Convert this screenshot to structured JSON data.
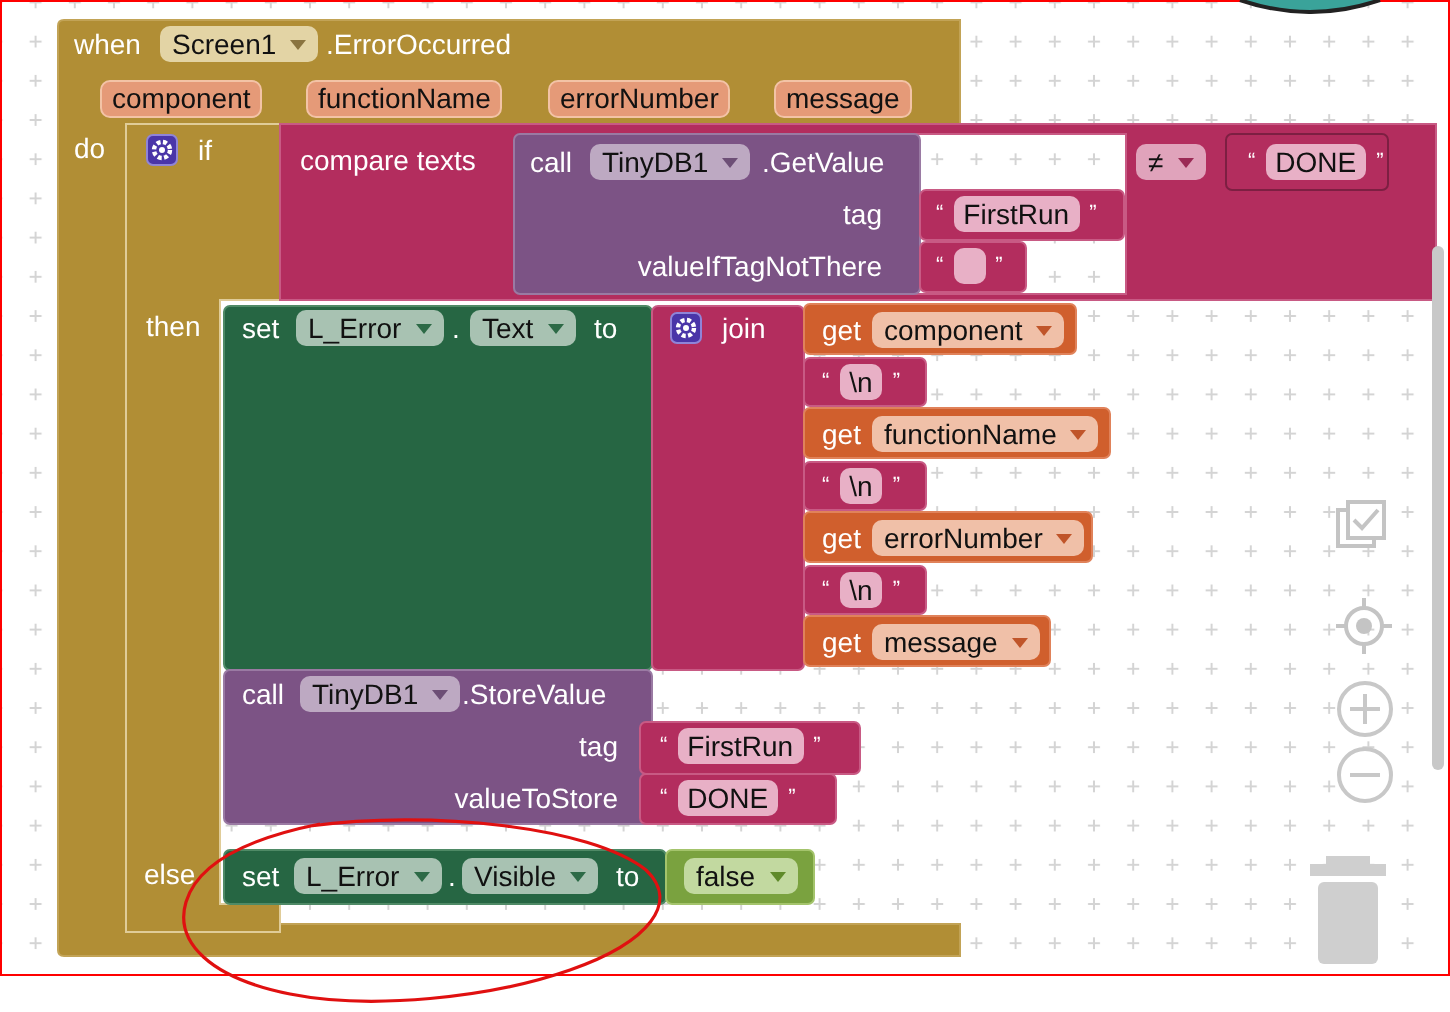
{
  "event": {
    "keyword": "when",
    "component": "Screen1",
    "event_name": ".ErrorOccurred",
    "params": [
      "component",
      "functionName",
      "errorNumber",
      "message"
    ],
    "do_label": "do"
  },
  "if_block": {
    "keyword": "if",
    "then_label": "then",
    "else_label": "else"
  },
  "condition": {
    "label": "compare texts",
    "call": {
      "keyword": "call",
      "component": "TinyDB1",
      "method": ".GetValue",
      "args": [
        {
          "name": "tag",
          "open": "“",
          "value": "FirstRun",
          "close": "”"
        },
        {
          "name": "valueIfTagNotThere",
          "open": "“",
          "close": "”"
        }
      ]
    },
    "operator": "≠",
    "right": {
      "open": "“",
      "value": "DONE",
      "close": "”"
    }
  },
  "then": [
    {
      "kind": "set",
      "keyword": "set",
      "component": "L_Error",
      "dot": ".",
      "property": "Text",
      "to": "to",
      "value": {
        "kind": "join",
        "label": "join",
        "items": [
          {
            "kind": "get",
            "keyword": "get",
            "name": "component"
          },
          {
            "kind": "text",
            "open": "“",
            "value": "\\n",
            "close": "”"
          },
          {
            "kind": "get",
            "keyword": "get",
            "name": "functionName"
          },
          {
            "kind": "text",
            "open": "“",
            "value": "\\n",
            "close": "”"
          },
          {
            "kind": "get",
            "keyword": "get",
            "name": "errorNumber"
          },
          {
            "kind": "text",
            "open": "“",
            "value": "\\n",
            "close": "”"
          },
          {
            "kind": "get",
            "keyword": "get",
            "name": "message"
          }
        ]
      }
    },
    {
      "kind": "call",
      "keyword": "call",
      "component": "TinyDB1",
      "method": ".StoreValue",
      "args": [
        {
          "name": "tag",
          "open": "“",
          "value": "FirstRun",
          "close": "”"
        },
        {
          "name": "valueToStore",
          "open": "“",
          "value": "DONE",
          "close": "”"
        }
      ]
    }
  ],
  "else": [
    {
      "kind": "set",
      "keyword": "set",
      "component": "L_Error",
      "dot": ".",
      "property": "Visible",
      "to": "to",
      "value": {
        "kind": "bool",
        "value": "false"
      }
    }
  ]
}
